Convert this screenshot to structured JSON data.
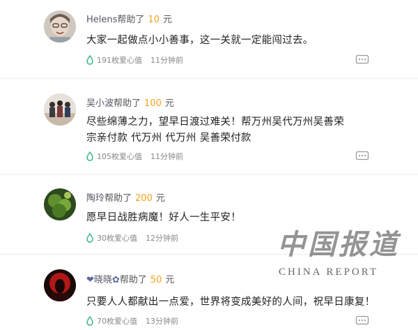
{
  "colors": {
    "amount": "#f0a21a",
    "drop": "#2ab27b",
    "text": "#222222",
    "meta": "#888888"
  },
  "watermark": {
    "cjk": "中国报道",
    "en": "CHINA  REPORT"
  },
  "comments": [
    {
      "name": "Helens",
      "helped_text": "帮助了",
      "amount": "10",
      "unit": "元",
      "message": "大家一起做点小小善事，这一关就一定能闯过去。",
      "love_value": "191枚爱心值",
      "time": "11分钟前",
      "avatar_icon": "child-portrait-avatar",
      "reply_icon": "comment-reply-icon"
    },
    {
      "name": "吴小波",
      "helped_text": "帮助了",
      "amount": "100",
      "unit": "元",
      "message": "尽些绵薄之力，望早日渡过难关！帮万州吴代万州吴善荣宗亲付款 代万州 代万州 吴善荣付款",
      "love_value": "105枚爱心值",
      "time": "11分钟前",
      "avatar_icon": "family-photo-avatar",
      "reply_icon": "comment-reply-icon"
    },
    {
      "name": "陶玲",
      "helped_text": "帮助了",
      "amount": "200",
      "unit": "元",
      "message": "愿早日战胜病魔！好人一生平安！",
      "love_value": "30枚爱心值",
      "time": "12分钟前",
      "avatar_icon": "green-plant-avatar",
      "reply_icon": "comment-reply-icon"
    },
    {
      "name": "晓晓",
      "name_prefix": "❤",
      "name_suffix": "✿",
      "helped_text": "帮助了",
      "amount": "50",
      "unit": "元",
      "message": "只要人人都献出一点爱，世界将变成美好的人间，祝早日康复！",
      "love_value": "70枚爱心值",
      "time": "13分钟前",
      "avatar_icon": "red-dark-avatar",
      "reply_icon": "comment-reply-icon"
    }
  ]
}
